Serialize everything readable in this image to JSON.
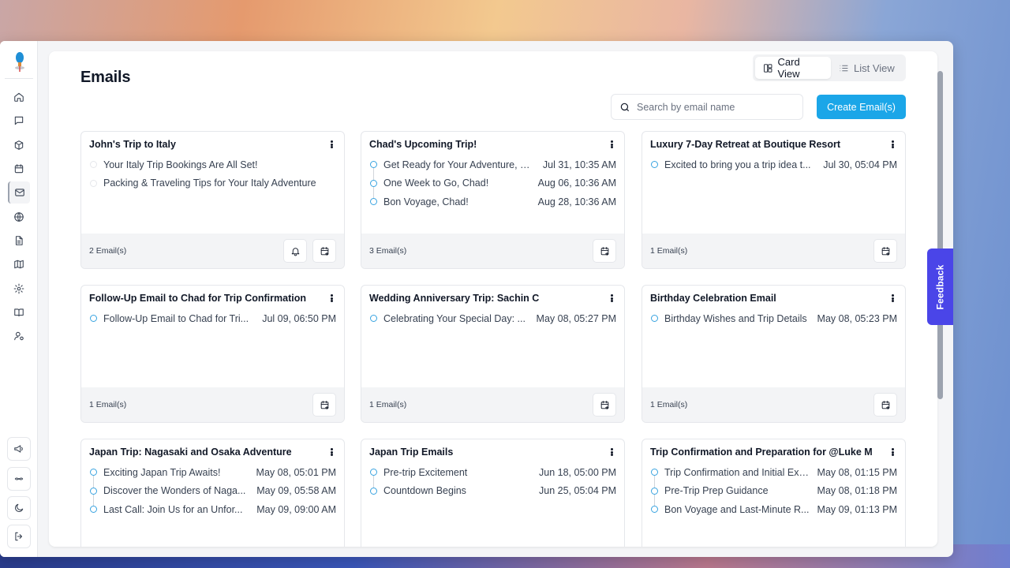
{
  "page": {
    "title": "Emails",
    "card_view_label": "Card View",
    "list_view_label": "List View",
    "search_placeholder": "Search by email name",
    "create_label": "Create Email(s)",
    "feedback_label": "Feedback"
  },
  "colors": {
    "accent": "#1ba6e8",
    "feedback": "#4a45e8",
    "timeline_dot": "#38a3e0"
  },
  "sidebar": {
    "top_items": [
      "home-icon",
      "chat-icon",
      "package-icon",
      "calendar-icon",
      "mail-icon",
      "globe-icon",
      "document-icon",
      "map-icon",
      "settings-icon",
      "book-icon",
      "user-settings-icon"
    ],
    "active_item": "mail-icon",
    "bottom_items": [
      "megaphone-icon",
      "integrations-icon",
      "moon-icon",
      "logout-icon"
    ]
  },
  "cards": [
    {
      "title": "John's Trip to Italy",
      "count": "2 Email(s)",
      "bell": true,
      "emails": [
        {
          "name": "Your Italy Trip Bookings Are All Set!",
          "date": "",
          "faint": true
        },
        {
          "name": "Packing & Traveling Tips for Your Italy Adventure",
          "date": "",
          "faint": true
        }
      ]
    },
    {
      "title": "Chad's Upcoming Trip!",
      "count": "3 Email(s)",
      "bell": false,
      "emails": [
        {
          "name": "Get Ready for Your Adventure, C...",
          "date": "Jul 31, 10:35 AM"
        },
        {
          "name": "One Week to Go, Chad!",
          "date": "Aug 06, 10:36 AM"
        },
        {
          "name": "Bon Voyage, Chad!",
          "date": "Aug 28, 10:36 AM"
        }
      ]
    },
    {
      "title": "Luxury 7-Day Retreat at Boutique Resort",
      "count": "1 Email(s)",
      "bell": false,
      "emails": [
        {
          "name": "Excited to bring you a trip idea t...",
          "date": "Jul 30, 05:04 PM"
        }
      ]
    },
    {
      "title": "Follow-Up Email to Chad for Trip Confirmation",
      "count": "1 Email(s)",
      "bell": false,
      "emails": [
        {
          "name": "Follow-Up Email to Chad for Tri...",
          "date": "Jul 09, 06:50 PM"
        }
      ]
    },
    {
      "title": "Wedding Anniversary Trip: Sachin C",
      "count": "1 Email(s)",
      "bell": false,
      "emails": [
        {
          "name": "Celebrating Your Special Day: ...",
          "date": "May 08, 05:27 PM"
        }
      ]
    },
    {
      "title": "Birthday Celebration Email",
      "count": "1 Email(s)",
      "bell": false,
      "emails": [
        {
          "name": "Birthday Wishes and Trip Details",
          "date": "May 08, 05:23 PM"
        }
      ]
    },
    {
      "title": "Japan Trip: Nagasaki and Osaka Adventure",
      "count": "",
      "bell": false,
      "emails": [
        {
          "name": "Exciting Japan Trip Awaits!",
          "date": "May 08, 05:01 PM"
        },
        {
          "name": "Discover the Wonders of Naga...",
          "date": "May 09, 05:58 AM"
        },
        {
          "name": "Last Call: Join Us for an Unfor...",
          "date": "May 09, 09:00 AM"
        }
      ]
    },
    {
      "title": "Japan Trip Emails",
      "count": "",
      "bell": false,
      "emails": [
        {
          "name": "Pre-trip Excitement",
          "date": "Jun 18, 05:00 PM"
        },
        {
          "name": "Countdown Begins",
          "date": "Jun 25, 05:04 PM"
        }
      ]
    },
    {
      "title": "Trip Confirmation and Preparation for @Luke M",
      "count": "",
      "bell": false,
      "emails": [
        {
          "name": "Trip Confirmation and Initial Exc...",
          "date": "May 08, 01:15 PM"
        },
        {
          "name": "Pre-Trip Prep Guidance",
          "date": "May 08, 01:18 PM"
        },
        {
          "name": "Bon Voyage and Last-Minute R...",
          "date": "May 09, 01:13 PM"
        }
      ]
    }
  ]
}
